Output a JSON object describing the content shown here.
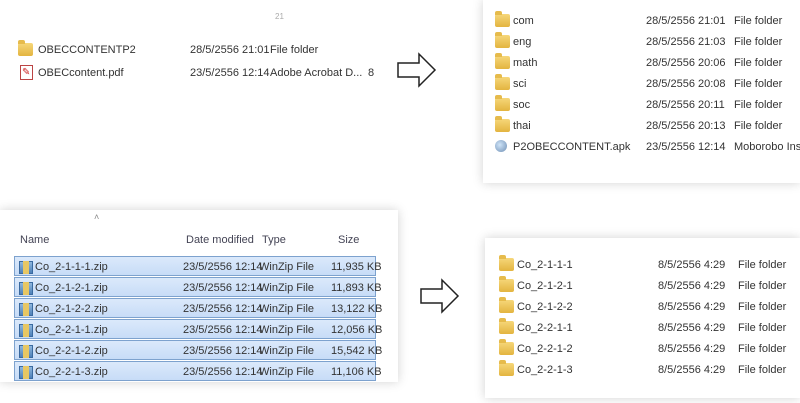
{
  "panel_tl": {
    "header_fragment": "21",
    "rows": [
      {
        "icon": "folder",
        "name": "OBECCONTENTP2",
        "date": "28/5/2556 21:01",
        "type": "File folder",
        "size": ""
      },
      {
        "icon": "pdf",
        "name": "OBECcontent.pdf",
        "date": "23/5/2556 12:14",
        "type": "Adobe Acrobat D...",
        "size": "8"
      }
    ]
  },
  "panel_tr": {
    "rows": [
      {
        "icon": "folder",
        "name": "com",
        "date": "28/5/2556 21:01",
        "type": "File folder"
      },
      {
        "icon": "folder",
        "name": "eng",
        "date": "28/5/2556 21:03",
        "type": "File folder"
      },
      {
        "icon": "folder",
        "name": "math",
        "date": "28/5/2556 20:06",
        "type": "File folder"
      },
      {
        "icon": "folder",
        "name": "sci",
        "date": "28/5/2556 20:08",
        "type": "File folder"
      },
      {
        "icon": "folder",
        "name": "soc",
        "date": "28/5/2556 20:11",
        "type": "File folder"
      },
      {
        "icon": "folder",
        "name": "thai",
        "date": "28/5/2556 20:13",
        "type": "File folder"
      },
      {
        "icon": "apk",
        "name": "P2OBECCONTENT.apk",
        "date": "23/5/2556 12:14",
        "type": "Moborobo Installer"
      }
    ]
  },
  "panel_bl": {
    "headers": {
      "name": "Name",
      "date": "Date modified",
      "type": "Type",
      "size": "Size"
    },
    "rows": [
      {
        "name": "Co_2-1-1-1.zip",
        "date": "23/5/2556 12:14",
        "type": "WinZip File",
        "size": "11,935 KB"
      },
      {
        "name": "Co_2-1-2-1.zip",
        "date": "23/5/2556 12:14",
        "type": "WinZip File",
        "size": "11,893 KB"
      },
      {
        "name": "Co_2-1-2-2.zip",
        "date": "23/5/2556 12:14",
        "type": "WinZip File",
        "size": "13,122 KB"
      },
      {
        "name": "Co_2-2-1-1.zip",
        "date": "23/5/2556 12:14",
        "type": "WinZip File",
        "size": "12,056 KB"
      },
      {
        "name": "Co_2-2-1-2.zip",
        "date": "23/5/2556 12:14",
        "type": "WinZip File",
        "size": "15,542 KB"
      },
      {
        "name": "Co_2-2-1-3.zip",
        "date": "23/5/2556 12:14",
        "type": "WinZip File",
        "size": "11,106 KB"
      }
    ]
  },
  "panel_br": {
    "rows": [
      {
        "name": "Co_2-1-1-1",
        "date": "8/5/2556 4:29",
        "type": "File folder"
      },
      {
        "name": "Co_2-1-2-1",
        "date": "8/5/2556 4:29",
        "type": "File folder"
      },
      {
        "name": "Co_2-1-2-2",
        "date": "8/5/2556 4:29",
        "type": "File folder"
      },
      {
        "name": "Co_2-2-1-1",
        "date": "8/5/2556 4:29",
        "type": "File folder"
      },
      {
        "name": "Co_2-2-1-2",
        "date": "8/5/2556 4:29",
        "type": "File folder"
      },
      {
        "name": "Co_2-2-1-3",
        "date": "8/5/2556 4:29",
        "type": "File folder"
      }
    ]
  }
}
